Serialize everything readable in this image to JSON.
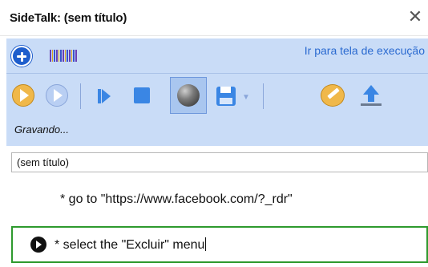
{
  "window": {
    "title": "SideTalk: (sem título)",
    "close_glyph": "✕"
  },
  "topbar": {
    "add_icon": "plus-circle-icon",
    "barcode_icon": "barcode-icon",
    "goto_link": "Ir para tela de execução"
  },
  "toolbar": {
    "buttons": [
      {
        "name": "play-bubble-icon"
      },
      {
        "name": "play-bubble-light-icon"
      },
      {
        "name": "step-icon"
      },
      {
        "name": "stop-icon"
      },
      {
        "name": "record-icon",
        "active": true
      },
      {
        "name": "save-icon"
      },
      {
        "name": "note-icon"
      },
      {
        "name": "upload-icon"
      }
    ],
    "status": "Gravando..."
  },
  "title_field": {
    "value": "(sem título)"
  },
  "steps": [
    {
      "text": "* go to \"https://www.facebook.com/?_rdr\""
    }
  ],
  "current_step": {
    "text": "* select the \"Excluir\" menu"
  },
  "colors": {
    "panel_bg": "#c9dcf7",
    "accent_blue": "#3a86e4",
    "link_blue": "#2a6ad0",
    "current_border": "#2e9a2e"
  }
}
